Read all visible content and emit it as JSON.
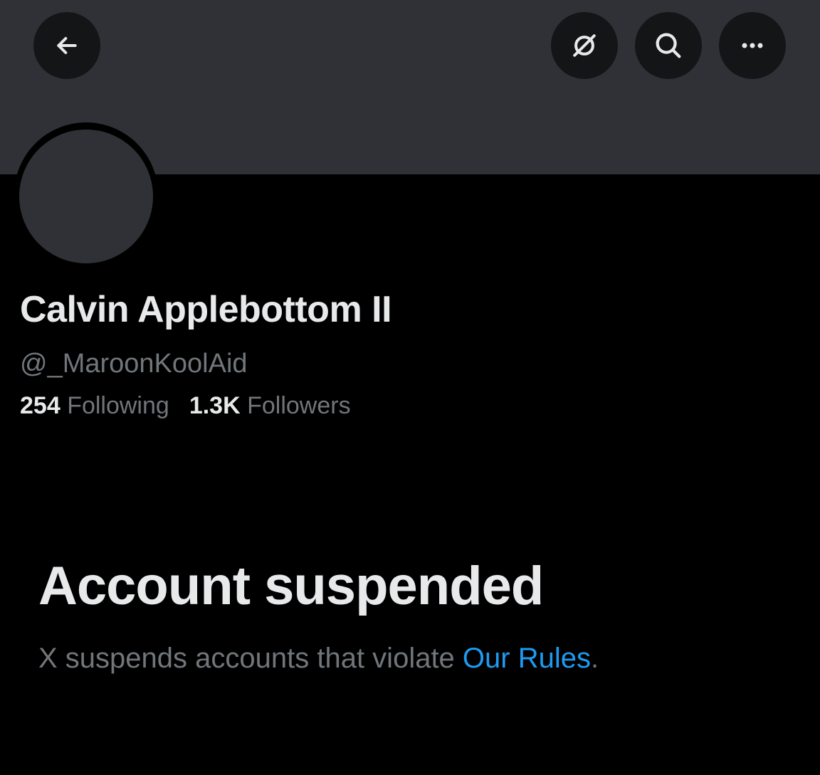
{
  "header": {
    "back_icon": "arrow-left-icon",
    "grok_icon": "slashed-circle-icon",
    "search_icon": "search-icon",
    "more_icon": "more-horizontal-icon",
    "banner_color": "#2f3136"
  },
  "profile": {
    "display_name": "Calvin Applebottom II",
    "handle": "@_MaroonKoolAid",
    "following_count": "254",
    "following_label": "Following",
    "followers_count": "1.3K",
    "followers_label": "Followers"
  },
  "suspension": {
    "title": "Account suspended",
    "message": "X suspends accounts that violate ",
    "rules_link": "Our Rules",
    "message_end": "."
  },
  "colors": {
    "background": "#000000",
    "primary_text": "#e7e9ea",
    "secondary_text": "#71767b",
    "link": "#1d9bf0"
  }
}
